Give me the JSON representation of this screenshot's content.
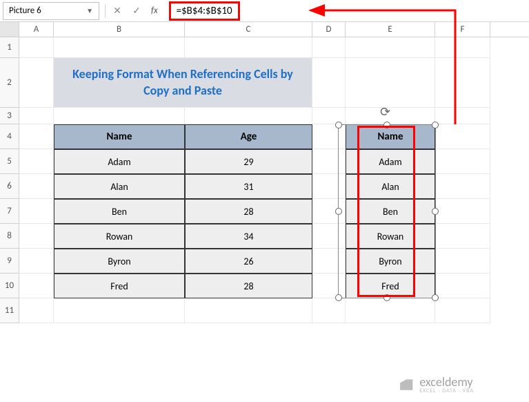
{
  "nameBox": "Picture 6",
  "formulaBar": "=$B$4:$B$10",
  "columns": [
    "A",
    "B",
    "C",
    "D",
    "E",
    "F"
  ],
  "rowNumbers": [
    "1",
    "2",
    "3",
    "4",
    "5",
    "6",
    "7",
    "8",
    "9",
    "10",
    "11"
  ],
  "title": "Keeping Format When Referencing Cells by Copy and Paste",
  "headers": {
    "name": "Name",
    "age": "Age"
  },
  "tableRows": [
    {
      "name": "Adam",
      "age": "29"
    },
    {
      "name": "Alan",
      "age": "31"
    },
    {
      "name": "Ben",
      "age": "28"
    },
    {
      "name": "Rowan",
      "age": "34"
    },
    {
      "name": "Byron",
      "age": "26"
    },
    {
      "name": "Fred",
      "age": "28"
    }
  ],
  "pastedHeader": "Name",
  "pastedRows": [
    "Adam",
    "Alan",
    "Ben",
    "Rowan",
    "Byron",
    "Fred"
  ],
  "watermark": {
    "main": "exceldemy",
    "sub": "EXCEL · DATA · VBA"
  }
}
